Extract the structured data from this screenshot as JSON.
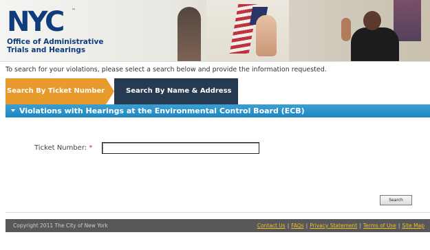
{
  "header": {
    "logo_text": "NYC",
    "logo_tm": "™",
    "org_name_line1": "Office of Administrative",
    "org_name_line2": "Trials and Hearings",
    "brand_color": "#0e3c7c"
  },
  "instructions": "To search for your violations, please select a search below and provide the information requested.",
  "tabs": [
    {
      "label": "Search By Ticket Number",
      "active": true,
      "color": "#e89a2c"
    },
    {
      "label": "Search By Name & Address",
      "active": false,
      "color": "#263a52"
    }
  ],
  "section": {
    "title": "Violations with Hearings at the Environmental Control Board (ECB)",
    "color": "#1f86c1",
    "icon": "caret-down-icon"
  },
  "form": {
    "ticket_label": "Ticket Number:",
    "required_marker": "*",
    "ticket_value": "",
    "search_button": "Search"
  },
  "footer": {
    "copyright": "Copyright 2011 The City of New York",
    "links": [
      "Contact Us",
      "FAQs",
      "Privacy Statement",
      "Terms of Use",
      "Site Map"
    ],
    "separator": "|",
    "link_color": "#f0c020"
  }
}
